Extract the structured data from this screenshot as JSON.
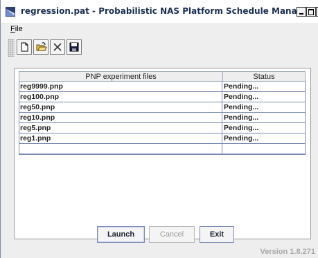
{
  "window": {
    "title": "regression.pat - Probabilistic NAS Platform Schedule Manager",
    "app_icon": "nas-logo-icon",
    "controls": [
      "minimize-icon",
      "maximize-icon",
      "close-icon"
    ],
    "close_glyph": "×"
  },
  "menubar": {
    "file_label": "File",
    "file_mnemonic": "F",
    "file_rest": "ile"
  },
  "toolbar": {
    "items": [
      "new-file-icon",
      "open-folder-icon",
      "delete-icon",
      "save-icon"
    ]
  },
  "table": {
    "headers": [
      "PNP experiment files",
      "Status"
    ],
    "rows": [
      {
        "file": "reg9999.pnp",
        "status": "Pending..."
      },
      {
        "file": "reg100.pnp",
        "status": "Pending..."
      },
      {
        "file": "reg50.pnp",
        "status": "Pending..."
      },
      {
        "file": "reg10.pnp",
        "status": "Pending..."
      },
      {
        "file": "reg5.pnp",
        "status": "Pending..."
      },
      {
        "file": "reg1.pnp",
        "status": "Pending..."
      }
    ]
  },
  "buttons": {
    "launch": "Launch",
    "cancel": "Cancel",
    "exit": "Exit"
  },
  "status": {
    "version": "Version 1.8.271"
  },
  "colors": {
    "title_text": "#1a2f55",
    "grid_lines": "#7a8ab5",
    "disabled_text": "#9a9a9a"
  }
}
